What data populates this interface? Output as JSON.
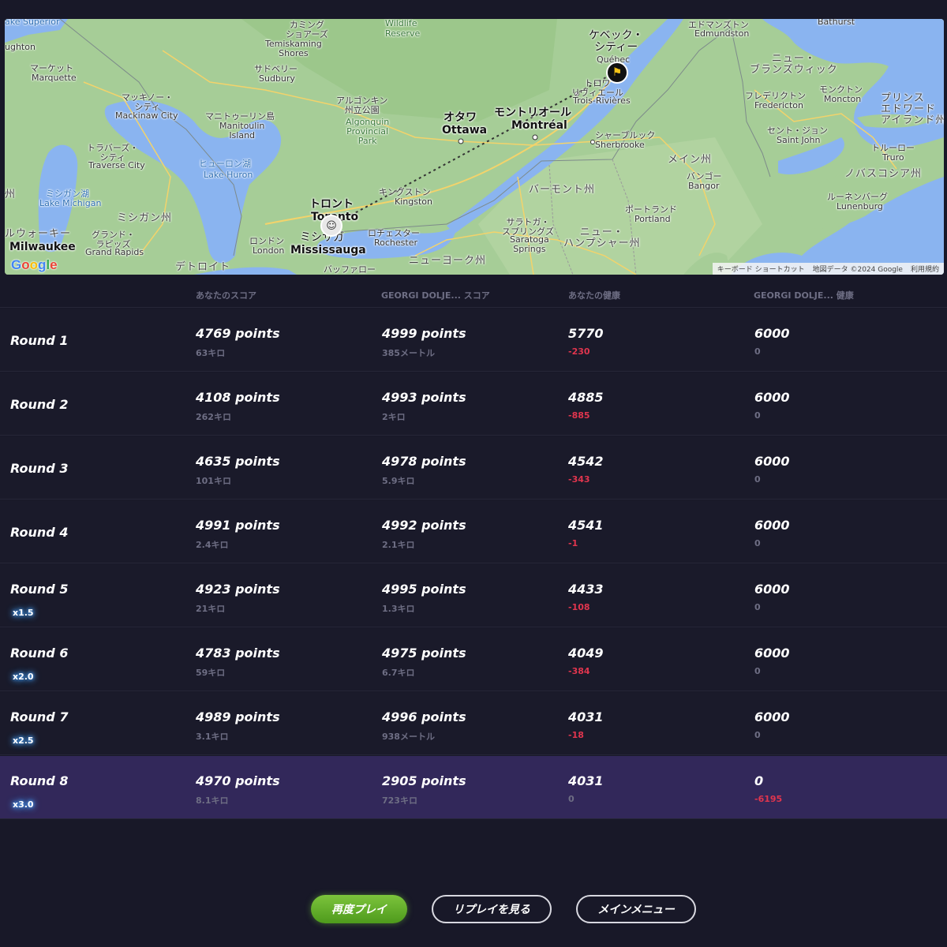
{
  "map": {
    "labels": {
      "lake_superior": "ake Superior",
      "ughton": "ughton",
      "marquette_jp": "マーケット",
      "marquette": "Marquette",
      "wildlife": "Wildlife",
      "reserve": "Reserve",
      "temiskaming_jp": "カミング\nショアーズ",
      "temiskaming": "Temiskaming\nShores",
      "sudbury_jp": "サドベリー",
      "sudbury": "Sudbury",
      "mackinaw_jp": "マッキノー・\nシティ",
      "mackinaw": "Mackinaw City",
      "manitoulin_jp": "マニトゥーリン島",
      "manitoulin": "Manitoulin\nIsland",
      "algonquin_jp": "アルゴンキン\n州立公園",
      "algonquin": "Algonquin\nProvincial\nPark",
      "ottawa_jp": "オタワ",
      "ottawa": "Ottawa",
      "montreal_jp": "モントリオール",
      "montreal": "Montréal",
      "quebec_jp": "ケベック・\nシティー",
      "quebec": "Québec",
      "trois_jp": "トロワ\nリヴィエール",
      "trois": "Trois-Rivières",
      "sherbrooke_jp": "シャーブルック",
      "sherbrooke": "Sherbrooke",
      "edmundston_jp": "エドマンズトン",
      "edmundston": "Edmundston",
      "bathurst": "Bathurst",
      "new_brunswick": "ニュー・\nブランズウィック",
      "fredericton_jp": "フレデリクトン",
      "fredericton": "Fredericton",
      "moncton_jp": "モンクトン",
      "moncton": "Moncton",
      "pei": "プリンス\nエドワード\nアイランド州",
      "saint_john_jp": "セント・ジョン",
      "saint_john": "Saint John",
      "truro_jp": "トルーロー",
      "truro": "Truro",
      "nova_scotia": "ノバスコシア州",
      "lunenburg_jp": "ルーネンバーグ",
      "lunenburg": "Lunenburg",
      "maine": "メイン州",
      "bangor_jp": "バンゴー",
      "bangor": "Bangor",
      "portland_jp": "ポートランド",
      "portland": "Portland",
      "vermont": "バーモント州",
      "nh": "ニュー・\nハンプシャー州",
      "saratoga_jp": "サラトガ・\nスプリングズ",
      "saratoga": "Saratoga\nSprings",
      "ny": "ニューヨーク州",
      "kingston_jp": "キングストン",
      "kingston": "Kingston",
      "rochester_jp": "ロチェスター",
      "rochester": "Rochester",
      "toronto_jp": "トロント",
      "toronto": "Toronto",
      "mississauga_jp": "ミシサガ",
      "mississauga": "Mississauga",
      "buffalo_jp": "バッファロー",
      "london_jp": "ロンドン",
      "london": "London",
      "detroit_jp": "デトロイト",
      "lake_huron_jp": "ヒューロン湖",
      "lake_huron": "Lake Huron",
      "traverse_jp": "トラバーズ・\nシティ",
      "traverse": "Traverse City",
      "lake_michigan_jp": "ミシガン湖",
      "lake_michigan": "Lake Michigan",
      "michigan": "ミシガン州",
      "grand_rapids_jp": "グランド・\nラピッズ",
      "grand_rapids": "Grand Rapids",
      "milwaukee_jp": "ルウォーキー",
      "milwaukee": "Milwaukee",
      "wi": "州"
    },
    "google_logo": [
      "G",
      "o",
      "o",
      "g",
      "l",
      "e"
    ],
    "attribution": {
      "shortcuts": "キーボード ショートカット",
      "map_data": "地図データ ©2024 Google",
      "terms": "利用規約"
    },
    "markers": {
      "actual": "flag-icon",
      "guess": "avatar-icon"
    }
  },
  "table": {
    "headers": {
      "round": "",
      "your_score": "あなたのスコア",
      "opponent_score": "GEORGI DOLJE... スコア",
      "your_health": "あなたの健康",
      "opponent_health": "GEORGI DOLJE... 健康"
    },
    "rows": [
      {
        "label": "Round 1",
        "multiplier": "",
        "your_points": "4769 points",
        "your_distance": "63キロ",
        "opp_points": "4999 points",
        "opp_distance": "385メートル",
        "your_health": "5770",
        "your_delta": "-230",
        "opp_health": "6000",
        "opp_delta": "0"
      },
      {
        "label": "Round 2",
        "multiplier": "",
        "your_points": "4108 points",
        "your_distance": "262キロ",
        "opp_points": "4993 points",
        "opp_distance": "2キロ",
        "your_health": "4885",
        "your_delta": "-885",
        "opp_health": "6000",
        "opp_delta": "0"
      },
      {
        "label": "Round 3",
        "multiplier": "",
        "your_points": "4635 points",
        "your_distance": "101キロ",
        "opp_points": "4978 points",
        "opp_distance": "5.9キロ",
        "your_health": "4542",
        "your_delta": "-343",
        "opp_health": "6000",
        "opp_delta": "0"
      },
      {
        "label": "Round 4",
        "multiplier": "",
        "your_points": "4991 points",
        "your_distance": "2.4キロ",
        "opp_points": "4992 points",
        "opp_distance": "2.1キロ",
        "your_health": "4541",
        "your_delta": "-1",
        "opp_health": "6000",
        "opp_delta": "0"
      },
      {
        "label": "Round 5",
        "multiplier": "x1.5",
        "your_points": "4923 points",
        "your_distance": "21キロ",
        "opp_points": "4995 points",
        "opp_distance": "1.3キロ",
        "your_health": "4433",
        "your_delta": "-108",
        "opp_health": "6000",
        "opp_delta": "0"
      },
      {
        "label": "Round 6",
        "multiplier": "x2.0",
        "your_points": "4783 points",
        "your_distance": "59キロ",
        "opp_points": "4975 points",
        "opp_distance": "6.7キロ",
        "your_health": "4049",
        "your_delta": "-384",
        "opp_health": "6000",
        "opp_delta": "0"
      },
      {
        "label": "Round 7",
        "multiplier": "x2.5",
        "your_points": "4989 points",
        "your_distance": "3.1キロ",
        "opp_points": "4996 points",
        "opp_distance": "938メートル",
        "your_health": "4031",
        "your_delta": "-18",
        "opp_health": "6000",
        "opp_delta": "0"
      },
      {
        "label": "Round 8",
        "multiplier": "x3.0",
        "your_points": "4970 points",
        "your_distance": "8.1キロ",
        "opp_points": "2905 points",
        "opp_distance": "723キロ",
        "your_health": "4031",
        "your_delta": "0",
        "opp_health": "0",
        "opp_delta": "-6195"
      }
    ]
  },
  "buttons": {
    "play_again": "再度プレイ",
    "watch_replay": "リプレイを見る",
    "main_menu": "メインメニュー"
  },
  "colors": {
    "background": "#181828",
    "row_bg": "#1a1a2a",
    "highlight_row": "#32285a",
    "negative": "#e0354e",
    "muted": "#6e6e84",
    "primary_button": "#6cb42c",
    "multiplier_glow": "#4aa3ff"
  }
}
